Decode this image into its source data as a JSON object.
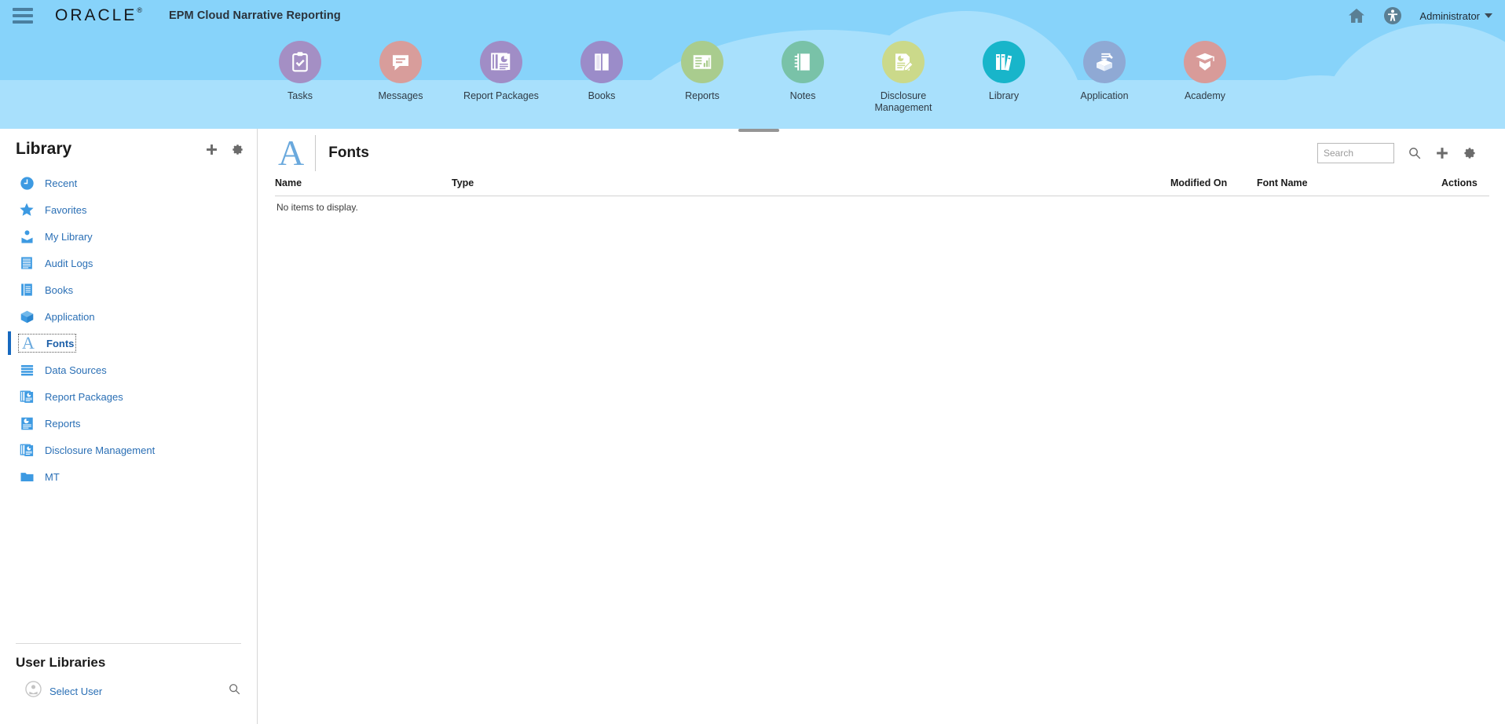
{
  "header": {
    "menu_icon": "hamburger-icon",
    "brand": "ORACLE",
    "brand_mark": "®",
    "app_title": "EPM Cloud Narrative Reporting",
    "home_icon": "home-icon",
    "accessibility_icon": "accessibility-icon",
    "user_label": "Administrator"
  },
  "nav": {
    "items": [
      {
        "label": "Tasks",
        "icon": "tasks-clipboard-icon",
        "color": "#a48fc4",
        "selected": false
      },
      {
        "label": "Messages",
        "icon": "messages-bubble-icon",
        "color": "#d89d9b",
        "selected": false
      },
      {
        "label": "Report Packages",
        "icon": "report-packages-icon",
        "color": "#a08dc6",
        "selected": false
      },
      {
        "label": "Books",
        "icon": "books-icon",
        "color": "#9b8cc9",
        "selected": false
      },
      {
        "label": "Reports",
        "icon": "reports-icon",
        "color": "#a9cc8e",
        "selected": false
      },
      {
        "label": "Notes",
        "icon": "notes-icon",
        "color": "#79c2a8",
        "selected": false
      },
      {
        "label": "Disclosure Management",
        "icon": "disclosure-management-icon",
        "color": "#cbd98a",
        "selected": false
      },
      {
        "label": "Library",
        "icon": "library-books-icon",
        "color": "#18b5ca",
        "selected": true
      },
      {
        "label": "Application",
        "icon": "application-box-icon",
        "color": "#8fa9d4",
        "selected": false
      },
      {
        "label": "Academy",
        "icon": "academy-cap-icon",
        "color": "#d89b99",
        "selected": false
      }
    ],
    "collapse_handle": "panel-collapse-handle"
  },
  "sidebar": {
    "title": "Library",
    "add_icon": "plus-icon",
    "settings_icon": "gear-icon",
    "items": [
      {
        "label": "Recent",
        "icon": "clock-icon",
        "selected": false
      },
      {
        "label": "Favorites",
        "icon": "star-icon",
        "selected": false
      },
      {
        "label": "My Library",
        "icon": "my-library-icon",
        "selected": false
      },
      {
        "label": "Audit Logs",
        "icon": "audit-logs-icon",
        "selected": false
      },
      {
        "label": "Books",
        "icon": "books-icon",
        "selected": false
      },
      {
        "label": "Application",
        "icon": "cube-icon",
        "selected": false
      },
      {
        "label": "Fonts",
        "icon": "fonts-letter-a-icon",
        "selected": true
      },
      {
        "label": "Data Sources",
        "icon": "data-sources-icon",
        "selected": false
      },
      {
        "label": "Report Packages",
        "icon": "report-packages-icon",
        "selected": false
      },
      {
        "label": "Reports",
        "icon": "reports-icon",
        "selected": false
      },
      {
        "label": "Disclosure Management",
        "icon": "disclosure-management-icon",
        "selected": false
      },
      {
        "label": "MT",
        "icon": "folder-icon",
        "selected": false
      }
    ],
    "user_libraries": {
      "title": "User Libraries",
      "select_user_label": "Select User",
      "avatar_icon": "user-avatar-icon",
      "search_icon": "search-icon"
    }
  },
  "main": {
    "page_glyph": "A",
    "page_title": "Fonts",
    "search": {
      "value": "",
      "placeholder": "Search",
      "search_icon": "search-icon",
      "add_icon": "plus-icon",
      "settings_icon": "gear-icon"
    },
    "table": {
      "columns": [
        "Name",
        "Type",
        "Modified On",
        "Font Name",
        "Actions"
      ],
      "rows": [],
      "empty_message": "No items to display."
    }
  },
  "colors": {
    "banner_sky": "#87d3fa",
    "cloud": "#a8e0fc",
    "link_blue": "#2a6fb5",
    "selected_marker": "#1769bf",
    "library_teal": "#18b5ca"
  }
}
